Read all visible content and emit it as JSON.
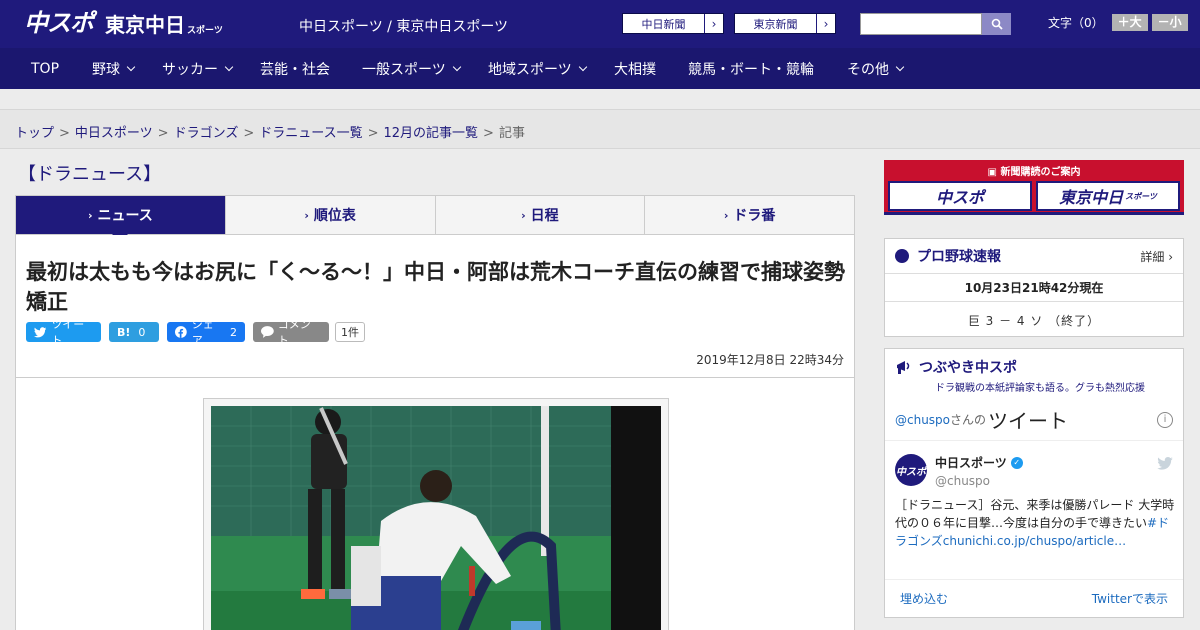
{
  "header": {
    "logo_main": "中スポ",
    "logo_tokyo": "東京中日",
    "logo_tokyo_sub": "スポーツ",
    "subtitle": "中日スポーツ / 東京中日スポーツ",
    "ext_links": [
      "中日新聞",
      "東京新聞"
    ],
    "fontsize_label": "文字（0）",
    "font_up": "＋大",
    "font_down": "－小"
  },
  "nav": {
    "items": [
      {
        "label": "TOP",
        "dropdown": false
      },
      {
        "label": "野球",
        "dropdown": true
      },
      {
        "label": "サッカー",
        "dropdown": true
      },
      {
        "label": "芸能・社会",
        "dropdown": false
      },
      {
        "label": "一般スポーツ",
        "dropdown": true
      },
      {
        "label": "地域スポーツ",
        "dropdown": true
      },
      {
        "label": "大相撲",
        "dropdown": false
      },
      {
        "label": "競馬・ボート・競輪",
        "dropdown": false
      },
      {
        "label": "その他",
        "dropdown": true
      }
    ]
  },
  "breadcrumb": {
    "links": [
      "トップ",
      "中日スポーツ",
      "ドラゴンズ",
      "ドラニュース一覧",
      "12月の記事一覧"
    ],
    "current": "記事"
  },
  "section_title": "【ドラニュース】",
  "tabs": [
    "ニュース",
    "順位表",
    "日程",
    "ドラ番"
  ],
  "article": {
    "headline": "最初は太もも今はお尻に「く～る～！」中日・阿部は荒木コーチ直伝の練習で捕球姿勢矯正",
    "share": {
      "tweet": "ツイート",
      "hatena": "B!",
      "hatena_count": "0",
      "facebook": "シェア",
      "facebook_count": "2",
      "comment": "コメント",
      "comment_count": "1件"
    },
    "date": "2019年12月8日 22時34分"
  },
  "sidebar": {
    "promo_title": "新聞購読のご案内",
    "promo_buttons": [
      "中スポ",
      "東京中日"
    ],
    "promo_tokyo_sub": "スポーツ",
    "baseball": {
      "title": "プロ野球速報",
      "detail": "詳細 ›",
      "updated": "10月23日21時42分現在",
      "score": "巨 3 － 4 ソ （終了）"
    },
    "twitter": {
      "title": "つぶやき中スポ",
      "subtitle": "ドラ観戦の本紙評論家も語る。グラも熱烈応援",
      "handle_label": "@chuspo",
      "san": "さんの",
      "tweet_word": "ツイート",
      "user_name": "中日スポーツ",
      "user_handle": "@chuspo",
      "tweet_text": "［ドラニュース］谷元、来季は優勝パレード 大学時代の０６年に目撃…今度は自分の手で導きたい",
      "tweet_link": "#ドラゴンズchunichi.co.jp/chuspo/article…",
      "embed": "埋め込む",
      "view": "Twitterで表示"
    }
  }
}
